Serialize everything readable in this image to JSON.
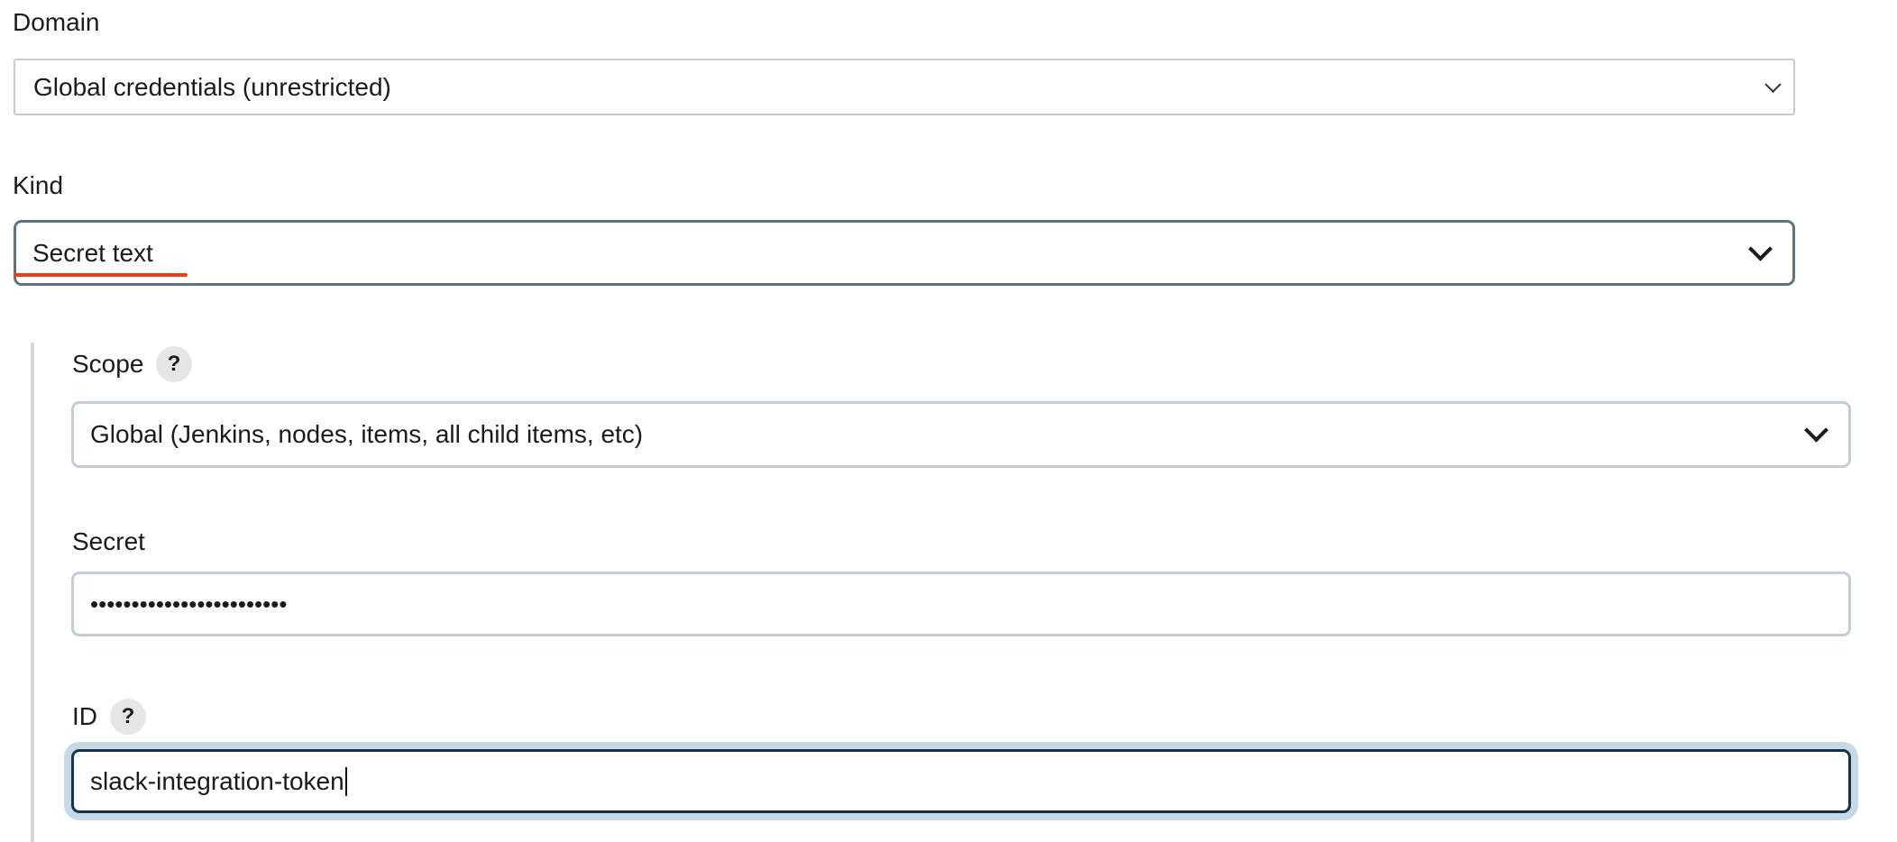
{
  "domain": {
    "label": "Domain",
    "selected": "Global credentials (unrestricted)"
  },
  "kind": {
    "label": "Kind",
    "selected": "Secret text"
  },
  "scope": {
    "label": "Scope",
    "help": "?",
    "selected": "Global (Jenkins, nodes, items, all child items, etc)"
  },
  "secret": {
    "label": "Secret",
    "masked_value": "••••••••••••••••••••••••"
  },
  "id": {
    "label": "ID",
    "help": "?",
    "value": "slack-integration-token"
  },
  "colors": {
    "focus_border": "#16334d",
    "focus_ring": "#c7d8e8",
    "kind_border": "#5f7282",
    "spellcheck_underline": "#e8401c"
  },
  "icons": {
    "select_arrow": "chevron-down-icon",
    "help": "help-icon"
  }
}
